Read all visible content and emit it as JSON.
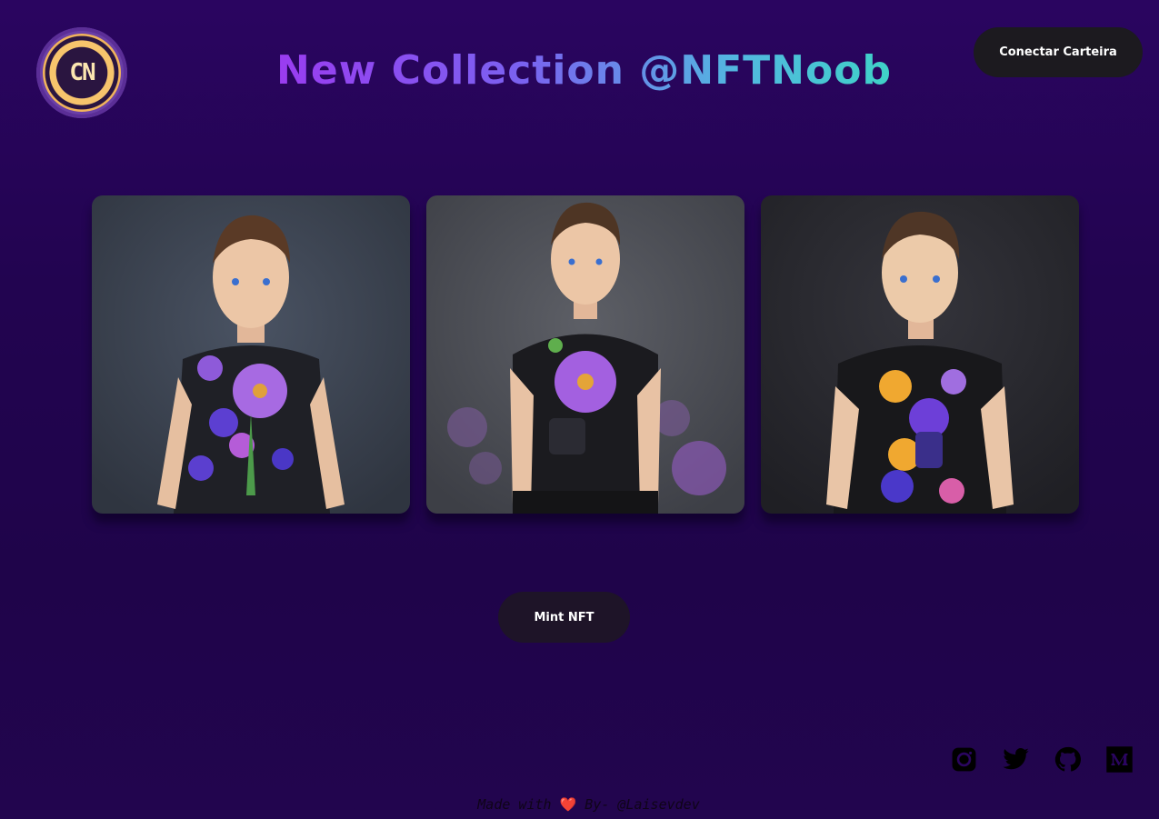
{
  "header": {
    "logo_text": "CN",
    "title": "New Collection @NFTNoob",
    "connect_button": "Conectar Carteira"
  },
  "nft_cards": [
    {
      "name": "nft-1",
      "colors": {
        "bg": "#3c4350",
        "shirt": "#1d1d22",
        "flower": "#9a5be0"
      }
    },
    {
      "name": "nft-2",
      "colors": {
        "bg": "#4e5058",
        "shirt": "#1b1b1e",
        "flower": "#a25ee6"
      }
    },
    {
      "name": "nft-3",
      "colors": {
        "bg": "#2b2b30",
        "shirt": "#171719",
        "flower": "#e8a72c"
      }
    }
  ],
  "mint_button": "Mint NFT",
  "socials": [
    {
      "icon": "instagram-icon"
    },
    {
      "icon": "twitter-icon"
    },
    {
      "icon": "github-icon"
    },
    {
      "icon": "medium-icon"
    }
  ],
  "footer": {
    "prefix": "Made with",
    "heart": "❤️",
    "suffix": "By- @Laisevdev"
  },
  "colors": {
    "background": "#220450",
    "button": "#1c1a1f",
    "title_gradient_start": "#9a3cf0",
    "title_gradient_end": "#3fd2c7"
  }
}
